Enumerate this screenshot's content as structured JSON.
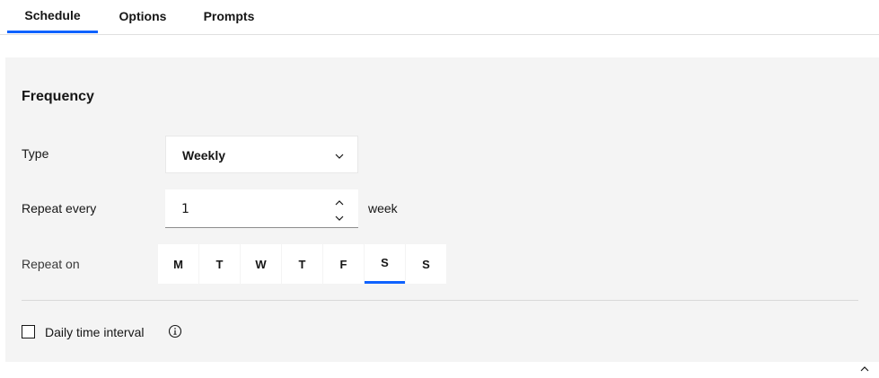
{
  "tabs": [
    {
      "label": "Schedule",
      "active": true
    },
    {
      "label": "Options",
      "active": false
    },
    {
      "label": "Prompts",
      "active": false
    }
  ],
  "frequency": {
    "title": "Frequency",
    "type_label": "Type",
    "type_value": "Weekly",
    "repeat_every_label": "Repeat every",
    "repeat_every_value": "1",
    "repeat_every_unit": "week",
    "repeat_on_label": "Repeat on",
    "days": [
      {
        "label": "M",
        "selected": false
      },
      {
        "label": "T",
        "selected": false
      },
      {
        "label": "W",
        "selected": false
      },
      {
        "label": "T",
        "selected": false
      },
      {
        "label": "F",
        "selected": false
      },
      {
        "label": "S",
        "selected": true
      },
      {
        "label": "S",
        "selected": false
      }
    ]
  },
  "daily_interval": {
    "label": "Daily time interval",
    "checked": false
  },
  "colors": {
    "accent": "#0f62fe",
    "panel_bg": "#f4f4f4"
  },
  "icons": [
    "chevron-down-icon",
    "caret-up-icon",
    "caret-down-icon",
    "info-icon",
    "chevron-up-icon"
  ]
}
